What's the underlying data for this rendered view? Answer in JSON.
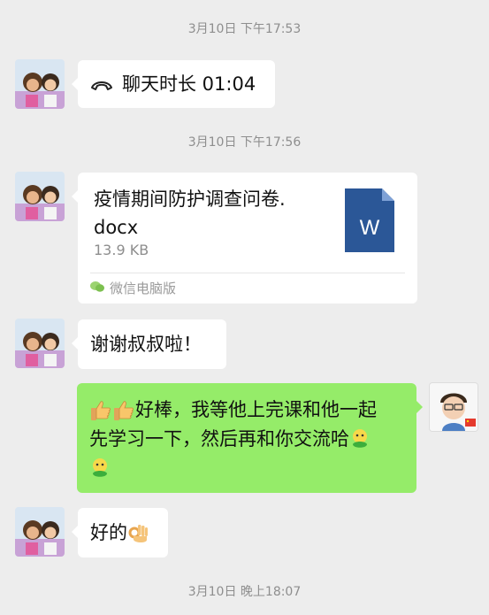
{
  "messages": {
    "ts1": "3月10日 下午17:53",
    "call_label": "聊天时长 01:04",
    "ts2": "3月10日 下午17:56",
    "file": {
      "name": "疫情期间防护调查问卷.docx",
      "name_line1": "疫情期间防护调查问卷.",
      "name_line2": "docx",
      "size": "13.9 KB",
      "source": "微信电脑版",
      "icon_letter": "W"
    },
    "thanks": "谢谢叔叔啦！",
    "reply_line1": "好棒，我等他上完课和他一起",
    "reply_line2": "先学习一下，然后再和你交流哈",
    "ok_text": "好的",
    "ts3": "3月10日 晚上18:07"
  },
  "colors": {
    "background": "#ededed",
    "self_bubble": "#95ec69",
    "other_bubble": "#ffffff",
    "word_icon": "#2b5797"
  }
}
